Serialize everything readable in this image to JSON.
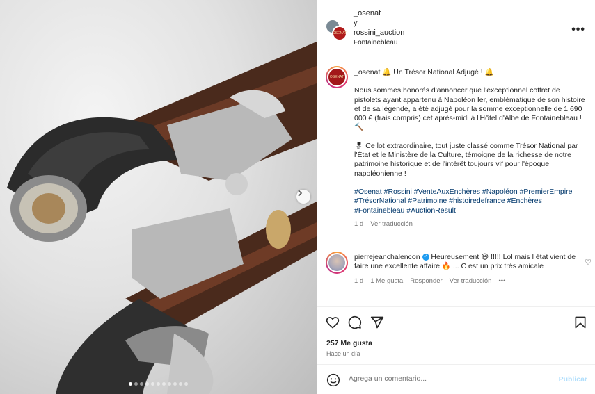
{
  "media": {
    "slide_count": 11,
    "active_slide": 1
  },
  "header": {
    "user1": "_osenat",
    "connector": "y",
    "user2": "rossini_auction",
    "location": "Fontainebleau"
  },
  "caption": {
    "user": "_osenat",
    "title": "🔔 Un Trésor National Adjugé ! 🔔",
    "para1": "Nous sommes honorés d'annoncer que l'exceptionnel coffret de pistolets ayant appartenu à Napoléon Ier, emblématique de son histoire et de sa légende, a été adjugé pour la somme exceptionnelle de 1 690 000 € (frais compris) cet après-midi à l'Hôtel d'Albe de Fontainebleau ! 🔨",
    "para2": "🎖 Ce lot extraordinaire, tout juste classé comme Trésor National par l'État et le Ministère de la Culture, témoigne de la richesse de notre patrimoine historique et de l'intérêt toujours vif pour l'époque napoléonienne !",
    "hashtags": "#Osenat #Rossini #VenteAuxEnchères #Napoléon #PremierEmpire #TrésorNational #Patrimoine #histoiredefrance #Enchères #Fontainebleau #AuctionResult",
    "age": "1 d",
    "translate": "Ver traducción"
  },
  "comment": {
    "user": "pierrejeanchalencon",
    "text": "Heureusement 😅 !!!!! Lol mais l état vient de faire une excellente affaire 🔥.... C est un prix très amicale",
    "age": "1 d",
    "likes": "1 Me gusta",
    "reply": "Responder",
    "translate": "Ver traducción",
    "more": "•••"
  },
  "stats": {
    "likes": "257 Me gusta",
    "time": "Hace un día"
  },
  "add_comment": {
    "placeholder": "Agrega un comentario...",
    "publish": "Publicar"
  },
  "logo_text": "OSENAT",
  "colors": {
    "link": "#00376b",
    "publish_disabled": "#b2dffc",
    "verified": "#1d9bf0"
  }
}
